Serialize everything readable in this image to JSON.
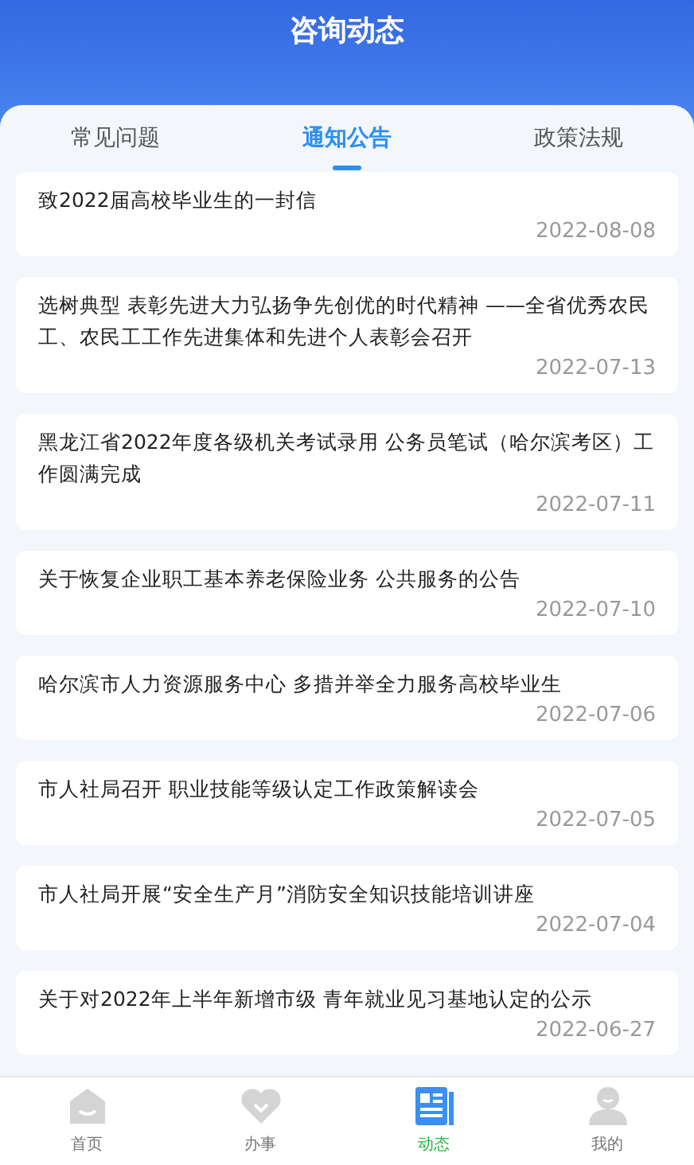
{
  "header": {
    "title": "咨询动态"
  },
  "tabs": [
    {
      "label": "常见问题",
      "selected": false
    },
    {
      "label": "通知公告",
      "selected": true
    },
    {
      "label": "政策法规",
      "selected": false
    }
  ],
  "articles": [
    {
      "title": "致2022届高校毕业生的一封信",
      "date": "2022-08-08"
    },
    {
      "title": "选树典型 表彰先进大力弘扬争先创优的时代精神 ——全省优秀农民工、农民工工作先进集体和先进个人表彰会召开",
      "date": "2022-07-13"
    },
    {
      "title": "黑龙江省2022年度各级机关考试录用 公务员笔试（哈尔滨考区）工作圆满完成",
      "date": "2022-07-11"
    },
    {
      "title": "关于恢复企业职工基本养老保险业务 公共服务的公告",
      "date": "2022-07-10"
    },
    {
      "title": "哈尔滨市人力资源服务中心 多措并举全力服务高校毕业生",
      "date": "2022-07-06"
    },
    {
      "title": "市人社局召开 职业技能等级认定工作政策解读会",
      "date": "2022-07-05"
    },
    {
      "title": "市人社局开展“安全生产月”消防安全知识技能培训讲座",
      "date": "2022-07-04"
    },
    {
      "title": "关于对2022年上半年新增市级 青年就业见习基地认定的公示",
      "date": "2022-06-27"
    }
  ],
  "bottom_nav": [
    {
      "kind": "home",
      "label": "首页",
      "selected": false
    },
    {
      "kind": "service",
      "label": "办事",
      "selected": false
    },
    {
      "kind": "news",
      "label": "动态",
      "selected": true
    },
    {
      "kind": "profile",
      "label": "我的",
      "selected": false
    }
  ]
}
